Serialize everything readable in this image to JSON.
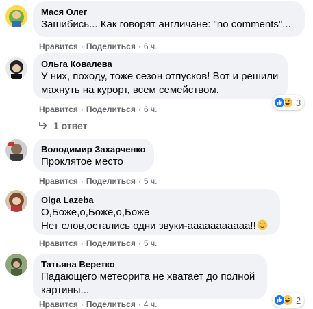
{
  "comments": [
    {
      "author": "Мася Олег",
      "text": "Зашибись... Как говорят англичане: \"no comments\"...",
      "like": "Нравится",
      "reply": "Поделиться",
      "time": "6 ч.",
      "reactions": null
    },
    {
      "author": "Ольга Ковалева",
      "text": "У них, походу, тоже сезон отпусков! Вот и решили\nмахнуть на курорт, всем семейством.",
      "like": "Нравится",
      "reply": "Поделиться",
      "time": "6 ч.",
      "reactions": "3"
    },
    {
      "author": "Володимир Захарченко",
      "text": "Проклятое место",
      "like": "Нравится",
      "reply": "Поделиться",
      "time": "5 ч.",
      "reactions": null
    },
    {
      "author": "Olga Lazeba",
      "text": "О,Боже,о,Боже,о,Боже\nНет слов,остались одни звуки-ааааааааааа!!",
      "like": "Нравится",
      "reply": "Поделиться",
      "time": "5 ч.",
      "reactions": null
    },
    {
      "author": "Татьяна Веретко",
      "text": "Падающего метеорита не хватает до полной\nкартины...",
      "like": "Нравится",
      "reply": "Поделиться",
      "time": "4 ч.",
      "reactions": "2"
    }
  ],
  "replies_link": "1 ответ",
  "separator": "·",
  "icons": {
    "reply_arrow": "reply-arrow-icon",
    "like_reaction": "like-reaction-icon",
    "haha_reaction": "haha-reaction-icon",
    "blush_emoji": "smiling-face-emoji"
  },
  "colors": {
    "bubble": "#f0f2f5",
    "meta": "#65676b",
    "like_blue": "#1877f2",
    "haha_yellow": "#f7c94a"
  }
}
